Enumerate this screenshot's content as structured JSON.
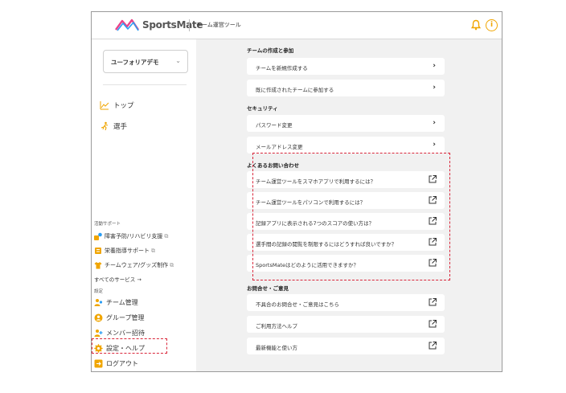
{
  "header": {
    "logo_text": "SportsMate",
    "app_name": "チーム運営ツール",
    "bell_icon": "bell-icon",
    "info_icon": "info-icon"
  },
  "sidebar": {
    "team_selector": {
      "value": "ユーフォリアデモ",
      "chevron": "⌄"
    },
    "main_items": [
      {
        "label": "トップ",
        "icon": "chart-icon"
      },
      {
        "label": "選手",
        "icon": "runner-icon"
      }
    ],
    "support_heading": "活動サポート",
    "support_items": [
      {
        "label": "障害予防/リハビリ支援",
        "icon": "rehab-icon"
      },
      {
        "label": "栄養指導サポート",
        "icon": "nutrition-icon"
      },
      {
        "label": "チームウェア/グッズ制作",
        "icon": "shirt-icon"
      }
    ],
    "all_services": "すべてのサービス →",
    "settings_heading": "設定",
    "settings_items": [
      {
        "label": "チーム管理",
        "icon": "team-icon"
      },
      {
        "label": "グループ管理",
        "icon": "group-icon"
      },
      {
        "label": "メンバー招待",
        "icon": "invite-icon"
      },
      {
        "label": "設定・ヘルプ",
        "icon": "gear-icon"
      },
      {
        "label": "ログアウト",
        "icon": "logout-icon"
      }
    ]
  },
  "main": {
    "team_section": {
      "heading": "チームの作成と参加",
      "items": [
        "チームを新規作成する",
        "既に作成されたチームに参加する"
      ]
    },
    "security_section": {
      "heading": "セキュリティ",
      "items": [
        "パスワード変更",
        "メールアドレス変更"
      ]
    },
    "faq_section": {
      "heading": "よくあるお問い合わせ",
      "items": [
        "チーム運営ツールをスマホアプリで利用するには？",
        "チーム運営ツールをパソコンで利用するには？",
        "記録アプリに表示される7つのスコアの使い方は？",
        "選手間の記録の閲覧を制限するにはどうすれば良いですか？",
        "SportsMateはどのように活用できますか？"
      ]
    },
    "contact_section": {
      "heading": "お問合せ・ご意見",
      "items": [
        "不具合のお問合せ・ご意見はこちら",
        "ご利用方法ヘルプ",
        "最新機能と使い方"
      ]
    },
    "arrow": "›"
  },
  "colors": {
    "highlight": "#d9263a",
    "accent": "#f0a500",
    "content_bg": "#f1f1f1"
  }
}
